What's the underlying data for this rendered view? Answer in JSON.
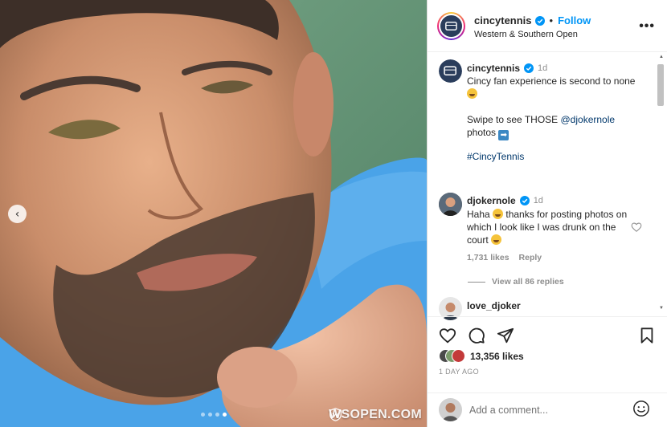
{
  "photo": {
    "watermark": "WSOPEN.COM",
    "carousel_count": 4,
    "carousel_active_index": 3,
    "prev_icon": "chevron-left-icon"
  },
  "header": {
    "username": "cincytennis",
    "separator": "•",
    "follow_label": "Follow",
    "location": "Western & Southern Open",
    "more_icon": "•••"
  },
  "caption": {
    "username": "cincytennis",
    "time": "1d",
    "line1": "Cincy fan experience is second to none",
    "line2_prefix": "Swipe to see THOSE ",
    "line2_mention": "@djokernole",
    "line3": "photos",
    "hashtag": "#CincyTennis"
  },
  "comments": [
    {
      "username": "djokernole",
      "time": "1d",
      "text_part1": "Haha ",
      "text_part2": " thanks for posting photos on which I look like I was drunk on the court ",
      "likes": "1,731 likes",
      "reply_label": "Reply",
      "view_replies": "View all 86 replies"
    },
    {
      "username": "love_djoker"
    }
  ],
  "actions": {
    "like_count": "13,356 likes",
    "date": "1 DAY AGO"
  },
  "add_comment": {
    "placeholder": "Add a comment..."
  },
  "colors": {
    "accent": "#0095f6",
    "link": "#00376b",
    "muted": "#8e8e8e",
    "shirt": "#4aa3e8"
  }
}
